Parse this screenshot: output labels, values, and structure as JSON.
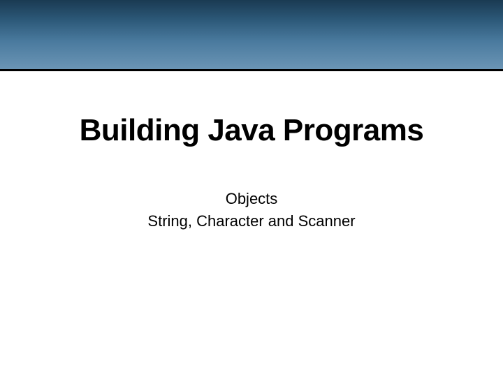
{
  "slide": {
    "title": "Building Java Programs",
    "subtitle_line1": "Objects",
    "subtitle_line2": "String, Character and Scanner"
  }
}
